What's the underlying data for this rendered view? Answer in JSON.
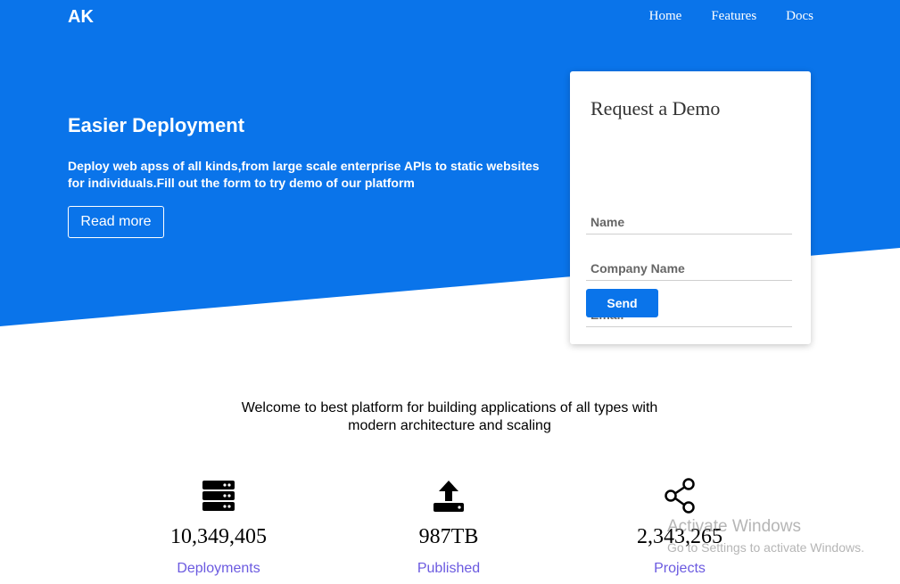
{
  "colors": {
    "primary": "#0a74ea",
    "link": "#6b5ae0"
  },
  "header": {
    "logo": "AK",
    "nav": [
      "Home",
      "Features",
      "Docs"
    ]
  },
  "hero": {
    "title": "Easier Deployment",
    "text": "Deploy web apss of all kinds,from large scale enterprise APIs to static websites for individuals.Fill out the form to try demo of our platform",
    "button": "Read more"
  },
  "demo_form": {
    "title": "Request a Demo",
    "name_placeholder": "Name",
    "company_placeholder": "Company Name",
    "email_placeholder": "Email",
    "send_label": "Send"
  },
  "welcome": "Welcome to best platform for building applications of all types with modern architecture and scaling",
  "stats": [
    {
      "icon": "server-icon",
      "value": "10,349,405",
      "label": "Deployments"
    },
    {
      "icon": "upload-icon",
      "value": "987TB",
      "label": "Published"
    },
    {
      "icon": "share-icon",
      "value": "2,343,265",
      "label": "Projects"
    }
  ],
  "watermark": {
    "line1": "Activate Windows",
    "line2": "Go to Settings to activate Windows."
  }
}
